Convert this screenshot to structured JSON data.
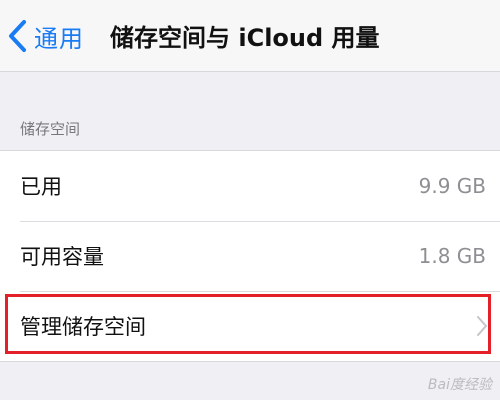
{
  "nav": {
    "back_label": "通用",
    "title": "储存空间与 iCloud 用量"
  },
  "storage_section": {
    "header": "储存空间",
    "rows": [
      {
        "label": "已用",
        "value": "9.9 GB"
      },
      {
        "label": "可用容量",
        "value": "1.8 GB"
      },
      {
        "label": "管理储存空间"
      }
    ]
  },
  "watermark": "Bai度经验",
  "colors": {
    "accent": "#1a7cf5",
    "highlight": "#e3202a",
    "background": "#efeff4"
  },
  "icons": {
    "back": "chevron-left-icon",
    "disclosure": "chevron-right-icon"
  }
}
